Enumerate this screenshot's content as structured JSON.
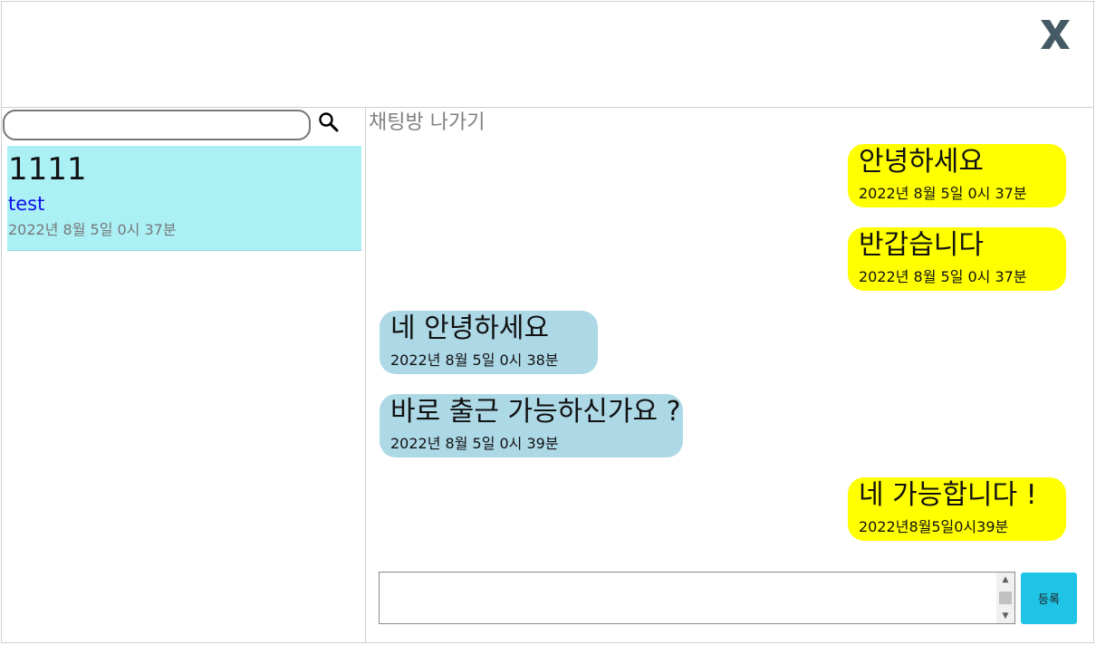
{
  "header": {
    "close_icon": "close-x-icon",
    "close_color": "#455a64"
  },
  "sidebar": {
    "search": {
      "value": "",
      "placeholder": ""
    },
    "search_icon": "magnifier-icon",
    "rooms": [
      {
        "name": "1111",
        "last_message": "test",
        "time": "2022년 8월 5일 0시 37분",
        "bg": "#aaf0f5"
      }
    ]
  },
  "chat": {
    "leave_label": "채팅방 나가기",
    "messages": [
      {
        "sender": "me",
        "text": "안녕하세요",
        "time": "2022년 8월 5일 0시 37분"
      },
      {
        "sender": "me",
        "text": "반갑습니다",
        "time": "2022년 8월 5일 0시 37분"
      },
      {
        "sender": "other",
        "text": "네 안녕하세요",
        "time": "2022년 8월 5일 0시 38분"
      },
      {
        "sender": "other",
        "text": "바로 출근 가능하신가요 ?",
        "time": "2022년 8월 5일 0시 39분"
      },
      {
        "sender": "me",
        "text": "네 가능합니다 !",
        "time": "2022년8월5일0시39분"
      }
    ],
    "composer": {
      "value": "",
      "placeholder": ""
    },
    "submit_label": "등록",
    "colors": {
      "mine": "#ffff00",
      "other": "#add8e6",
      "submit": "#1ec3e6"
    }
  }
}
